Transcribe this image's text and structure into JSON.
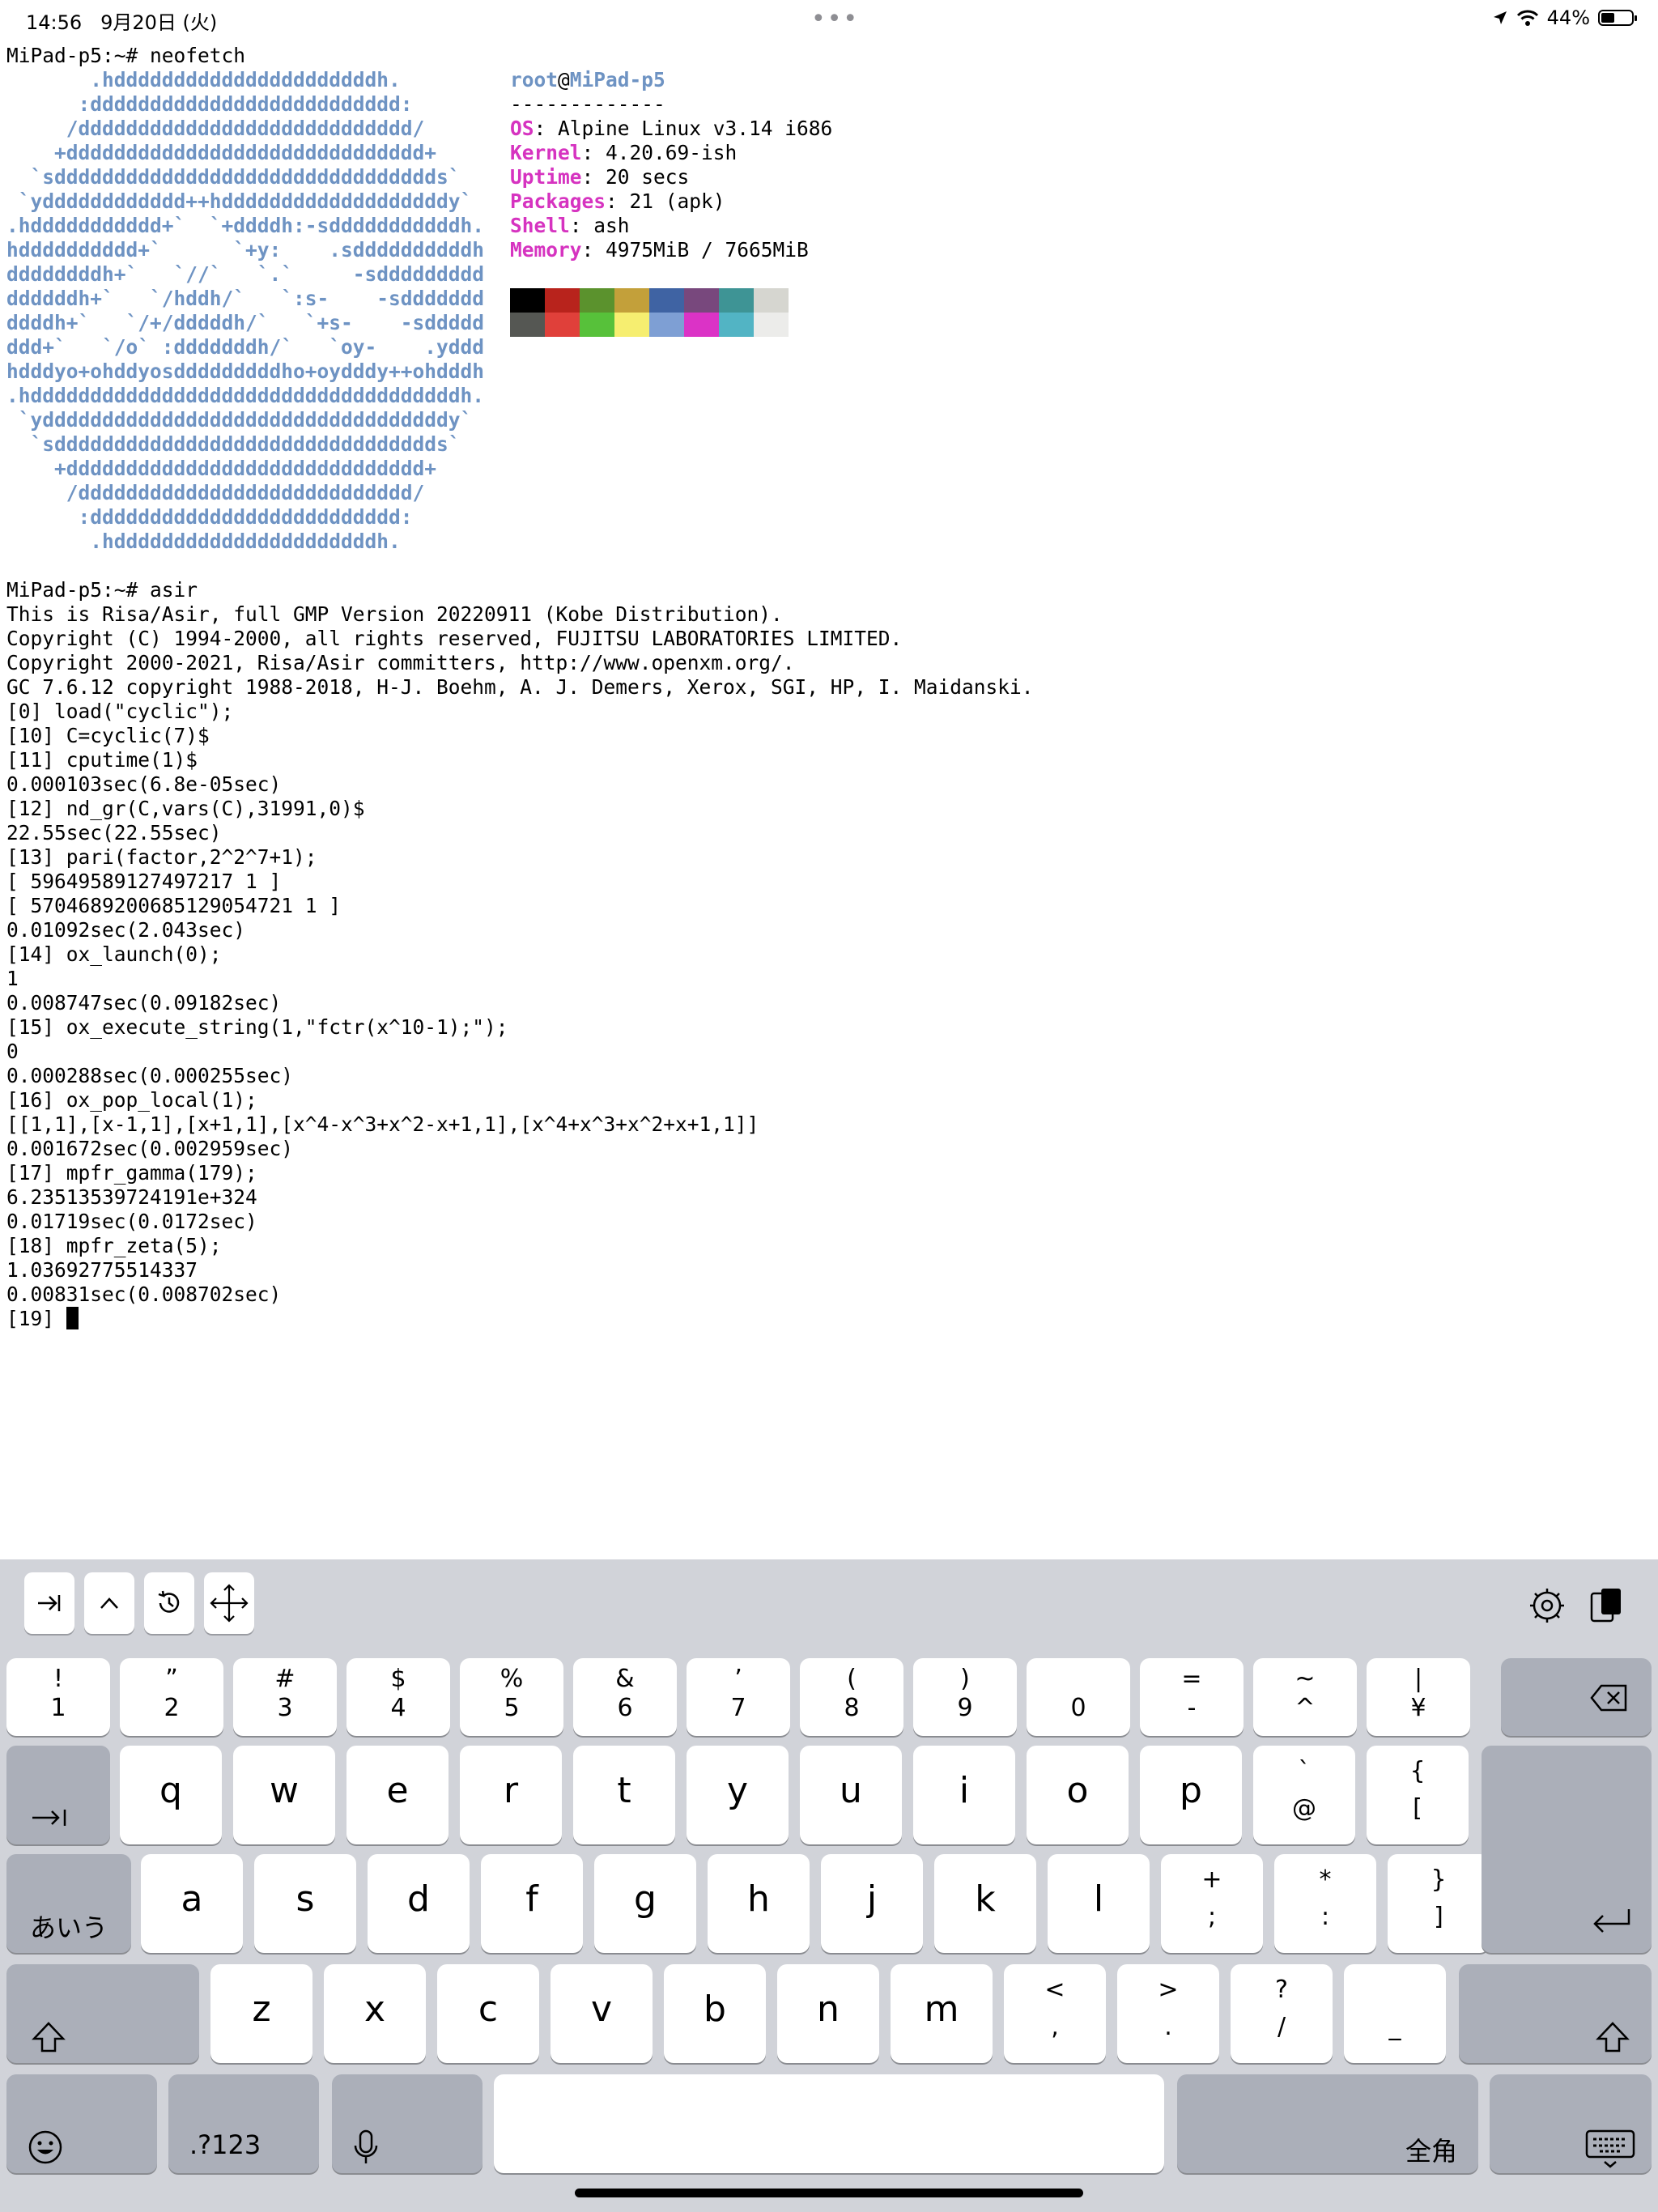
{
  "status_bar": {
    "time": "14:56",
    "date": "9月20日 (火)",
    "battery_text": "44%",
    "battery_level": 0.44,
    "icons": [
      "location-icon",
      "wifi-icon",
      "battery-icon"
    ]
  },
  "terminal": {
    "prompt1": "MiPad-p5:~# neofetch",
    "art": [
      "       .hddddddddddddddddddddddh.",
      "      :dddddddddddddddddddddddddd:",
      "     /dddddddddddddddddddddddddddd/",
      "    +dddddddddddddddddddddddddddddd+",
      "  `sdddddddddddddddddddddddddddddddds`",
      " `ydddddddddddd++hdddddddddddddddddddy`",
      ".hddddddddddd+`  `+ddddh:-sdddddddddddh.",
      "hdddddddddd+`      `+y:    .sddddddddddh",
      "ddddddddh+`   `//`   `.`     -sddddddddd",
      "ddddddh+`   `/hddh/`   `:s-    -sddddddd",
      "ddddh+`   `/+/dddddh/`   `+s-    -sddddd",
      "ddd+`   `/o` :dddddddh/`   `oy-    .yddd",
      "hdddyo+ohddyosdddddddddho+oydddy++ohdddh",
      ".hddddddddddddddddddddddddddddddddddddh.",
      " `yddddddddddddddddddddddddddddddddddy`",
      "  `sdddddddddddddddddddddddddddddddds`",
      "    +dddddddddddddddddddddddddddddd+",
      "     /dddddddddddddddddddddddddddd/",
      "      :dddddddddddddddddddddddddd:",
      "       .hddddddddddddddddddddddh."
    ],
    "info": {
      "user": "root",
      "at": "@",
      "host": "MiPad-p5",
      "separator": "-------------",
      "os_key": "OS",
      "os_val": ": Alpine Linux v3.14 i686",
      "kernel_key": "Kernel",
      "kernel_val": ": 4.20.69-ish",
      "uptime_key": "Uptime",
      "uptime_val": ": 20 secs",
      "packages_key": "Packages",
      "packages_val": ": 21 (apk)",
      "shell_key": "Shell",
      "shell_val": ": ash",
      "memory_key": "Memory",
      "memory_val": ": 4975MiB / 7665MiB"
    },
    "colors_row1": [
      "#000000",
      "#b8231c",
      "#5b922d",
      "#c3a03a",
      "#3f63a3",
      "#78487d",
      "#3e9495",
      "#d6d6d0"
    ],
    "colors_row2": [
      "#555753",
      "#e0403a",
      "#57c13a",
      "#f6ee70",
      "#7e9fd4",
      "#db33c6",
      "#52b4c4",
      "#ececea"
    ],
    "session": [
      "MiPad-p5:~# asir",
      "This is Risa/Asir, full GMP Version 20220911 (Kobe Distribution).",
      "Copyright (C) 1994-2000, all rights reserved, FUJITSU LABORATORIES LIMITED.",
      "Copyright 2000-2021, Risa/Asir committers, http://www.openxm.org/.",
      "GC 7.6.12 copyright 1988-2018, H-J. Boehm, A. J. Demers, Xerox, SGI, HP, I. Maidanski.",
      "[0] load(\"cyclic\");",
      "[10] C=cyclic(7)$",
      "[11] cputime(1)$",
      "0.000103sec(6.8e-05sec)",
      "[12] nd_gr(C,vars(C),31991,0)$",
      "22.55sec(22.55sec)",
      "[13] pari(factor,2^2^7+1);",
      "[ 59649589127497217 1 ]",
      "[ 5704689200685129054721 1 ]",
      "0.01092sec(2.043sec)",
      "[14] ox_launch(0);",
      "1",
      "0.008747sec(0.09182sec)",
      "[15] ox_execute_string(1,\"fctr(x^10-1);\");",
      "0",
      "0.000288sec(0.000255sec)",
      "[16] ox_pop_local(1);",
      "[[1,1],[x-1,1],[x+1,1],[x^4-x^3+x^2-x+1,1],[x^4+x^3+x^2+x+1,1]]",
      "0.001672sec(0.002959sec)",
      "[17] mpfr_gamma(179);",
      "6.23513539724191e+324",
      "0.01719sec(0.0172sec)",
      "[18] mpfr_zeta(5);",
      "1.03692775514337",
      "0.00831sec(0.008702sec)"
    ],
    "final_prompt": "[19] "
  },
  "keyboard": {
    "toolbar_left": [
      "tab-icon",
      "ctrl-icon",
      "history-icon",
      "move-icon"
    ],
    "toolbar_right": [
      "settings-icon",
      "paste-icon"
    ],
    "number_row": [
      {
        "top": "!",
        "bottom": "1"
      },
      {
        "top": "”",
        "bottom": "2"
      },
      {
        "top": "#",
        "bottom": "3"
      },
      {
        "top": "$",
        "bottom": "4"
      },
      {
        "top": "%",
        "bottom": "5"
      },
      {
        "top": "&",
        "bottom": "6"
      },
      {
        "top": "’",
        "bottom": "7"
      },
      {
        "top": "(",
        "bottom": "8"
      },
      {
        "top": ")",
        "bottom": "9"
      },
      {
        "top": "",
        "bottom": "0"
      },
      {
        "top": "=",
        "bottom": "-"
      },
      {
        "top": "~",
        "bottom": "^"
      },
      {
        "top": "|",
        "bottom": "¥"
      }
    ],
    "row_q": [
      "q",
      "w",
      "e",
      "r",
      "t",
      "y",
      "u",
      "i",
      "o",
      "p"
    ],
    "row_q_extra": [
      {
        "top": "`",
        "bottom": "@"
      },
      {
        "top": "{",
        "bottom": "["
      }
    ],
    "row_a": [
      "a",
      "s",
      "d",
      "f",
      "g",
      "h",
      "j",
      "k",
      "l"
    ],
    "row_a_extra": [
      {
        "top": "+",
        "bottom": ";"
      },
      {
        "top": "*",
        "bottom": ":"
      },
      {
        "top": "}",
        "bottom": "]"
      }
    ],
    "row_z": [
      "z",
      "x",
      "c",
      "v",
      "b",
      "n",
      "m"
    ],
    "row_z_extra": [
      {
        "top": "<",
        "bottom": ","
      },
      {
        "top": ">",
        "bottom": "."
      },
      {
        "top": "?",
        "bottom": "/"
      },
      {
        "top": "",
        "bottom": "_"
      }
    ],
    "kana_label": "あいう",
    "numbers_label": ".?123",
    "zenkaku_label": "全角"
  }
}
